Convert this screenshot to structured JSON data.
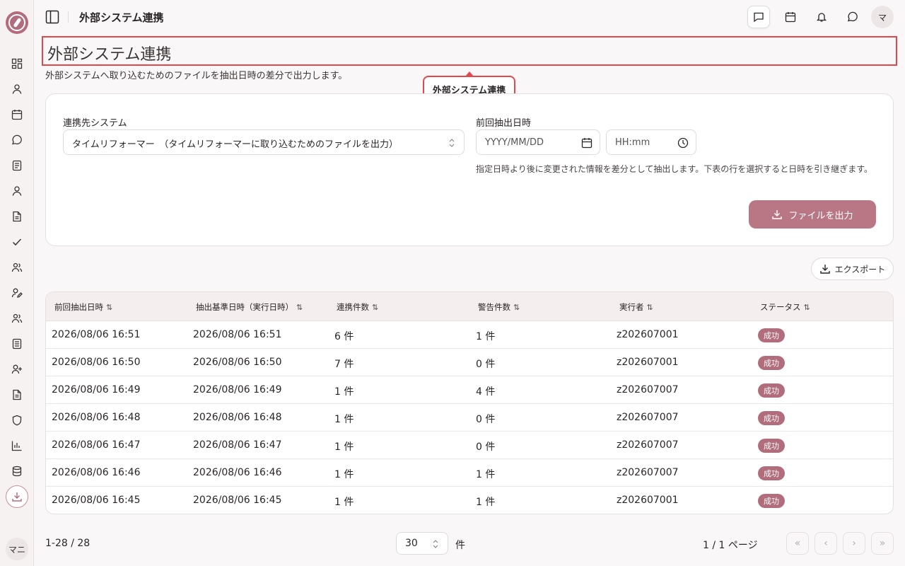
{
  "header": {
    "title": "外部システム連携",
    "avatar_initial": "マ"
  },
  "sidebar": {
    "user_initial": "マニ",
    "items": [
      {
        "icon": "dashboard-icon"
      },
      {
        "icon": "user-icon"
      },
      {
        "icon": "calendar-icon"
      },
      {
        "icon": "message-icon"
      },
      {
        "icon": "document-icon"
      },
      {
        "icon": "user-icon"
      },
      {
        "icon": "file-icon"
      },
      {
        "icon": "check-icon"
      },
      {
        "icon": "users-icon"
      },
      {
        "icon": "user-edit-icon"
      },
      {
        "icon": "users-icon"
      },
      {
        "icon": "list-icon"
      },
      {
        "icon": "user-plus-icon"
      },
      {
        "icon": "file-icon"
      },
      {
        "icon": "shield-icon"
      },
      {
        "icon": "chart-icon"
      },
      {
        "icon": "database-icon"
      },
      {
        "icon": "download-icon"
      }
    ]
  },
  "page": {
    "title": "外部システム連携",
    "description": "外部システムへ取り込むためのファイルを抽出日時の差分で出力します。",
    "tooltip": "外部システム連携"
  },
  "form": {
    "system_label": "連携先システム",
    "system_value": "タイムリフォーマー　（タイムリフォーマーに取り込むためのファイルを出力）",
    "prev_label": "前回抽出日時",
    "date_placeholder": "YYYY/MM/DD",
    "time_placeholder": "HH:mm",
    "hint": "指定日時より後に変更された情報を差分として抽出します。下表の行を選択すると日時を引き継ぎます。",
    "submit_label": "ファイルを出力"
  },
  "export_label": "エクスポート",
  "table": {
    "columns": [
      "前回抽出日時",
      "抽出基準日時（実行日時）",
      "連携件数",
      "警告件数",
      "実行者",
      "ステータス"
    ],
    "rows": [
      [
        "2026/08/06 16:51",
        "2026/08/06 16:51",
        "6 件",
        "1 件",
        "z202607001",
        "成功"
      ],
      [
        "2026/08/06 16:50",
        "2026/08/06 16:50",
        "7 件",
        "0 件",
        "z202607001",
        "成功"
      ],
      [
        "2026/08/06 16:49",
        "2026/08/06 16:49",
        "1 件",
        "4 件",
        "z202607007",
        "成功"
      ],
      [
        "2026/08/06 16:48",
        "2026/08/06 16:48",
        "1 件",
        "0 件",
        "z202607007",
        "成功"
      ],
      [
        "2026/08/06 16:47",
        "2026/08/06 16:47",
        "1 件",
        "0 件",
        "z202607007",
        "成功"
      ],
      [
        "2026/08/06 16:46",
        "2026/08/06 16:46",
        "1 件",
        "1 件",
        "z202607007",
        "成功"
      ],
      [
        "2026/08/06 16:45",
        "2026/08/06 16:45",
        "1 件",
        "1 件",
        "z202607001",
        "成功"
      ]
    ]
  },
  "pagination": {
    "range": "1-28 / 28",
    "page_size": "30",
    "unit": "件",
    "page_info": "1 / 1 ページ",
    "first": "«",
    "prev": "‹",
    "next": "›",
    "last": "»"
  },
  "colors": {
    "accent": "#b26d7d",
    "highlight": "#e0484b",
    "primary_button": "#b97786"
  }
}
